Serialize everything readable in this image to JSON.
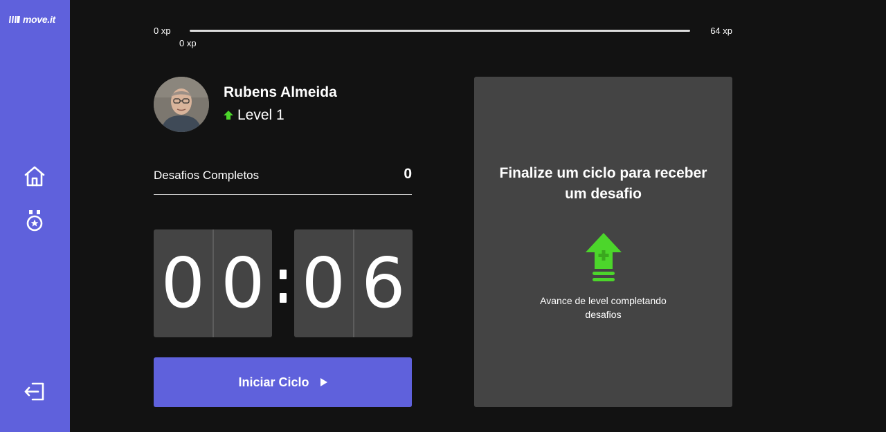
{
  "app": {
    "logo_text": "move.it"
  },
  "sidebar": {
    "items": [
      {
        "id": "home",
        "icon": "home-icon"
      },
      {
        "id": "rank",
        "icon": "medal-icon"
      }
    ],
    "logout_icon": "logout-icon"
  },
  "xp": {
    "min_label": "0 xp",
    "max_label": "64 xp",
    "current_label": "0 xp",
    "progress": 1.0
  },
  "profile": {
    "name": "Rubens Almeida",
    "level_label": "Level 1"
  },
  "challenges": {
    "label": "Desafios Completos",
    "count": "0"
  },
  "countdown": {
    "minute_left": "0",
    "minute_right": "0",
    "second_left": "0",
    "second_right": "6"
  },
  "cycle_button": {
    "label": "Iniciar Ciclo"
  },
  "challenge_panel": {
    "title": "Finalize um ciclo para receber um desafio",
    "description": "Avance de level completando desafios"
  },
  "colors": {
    "accent": "#5f61dc",
    "level_green": "#4cd62b",
    "background": "#121212",
    "card": "#444444"
  }
}
